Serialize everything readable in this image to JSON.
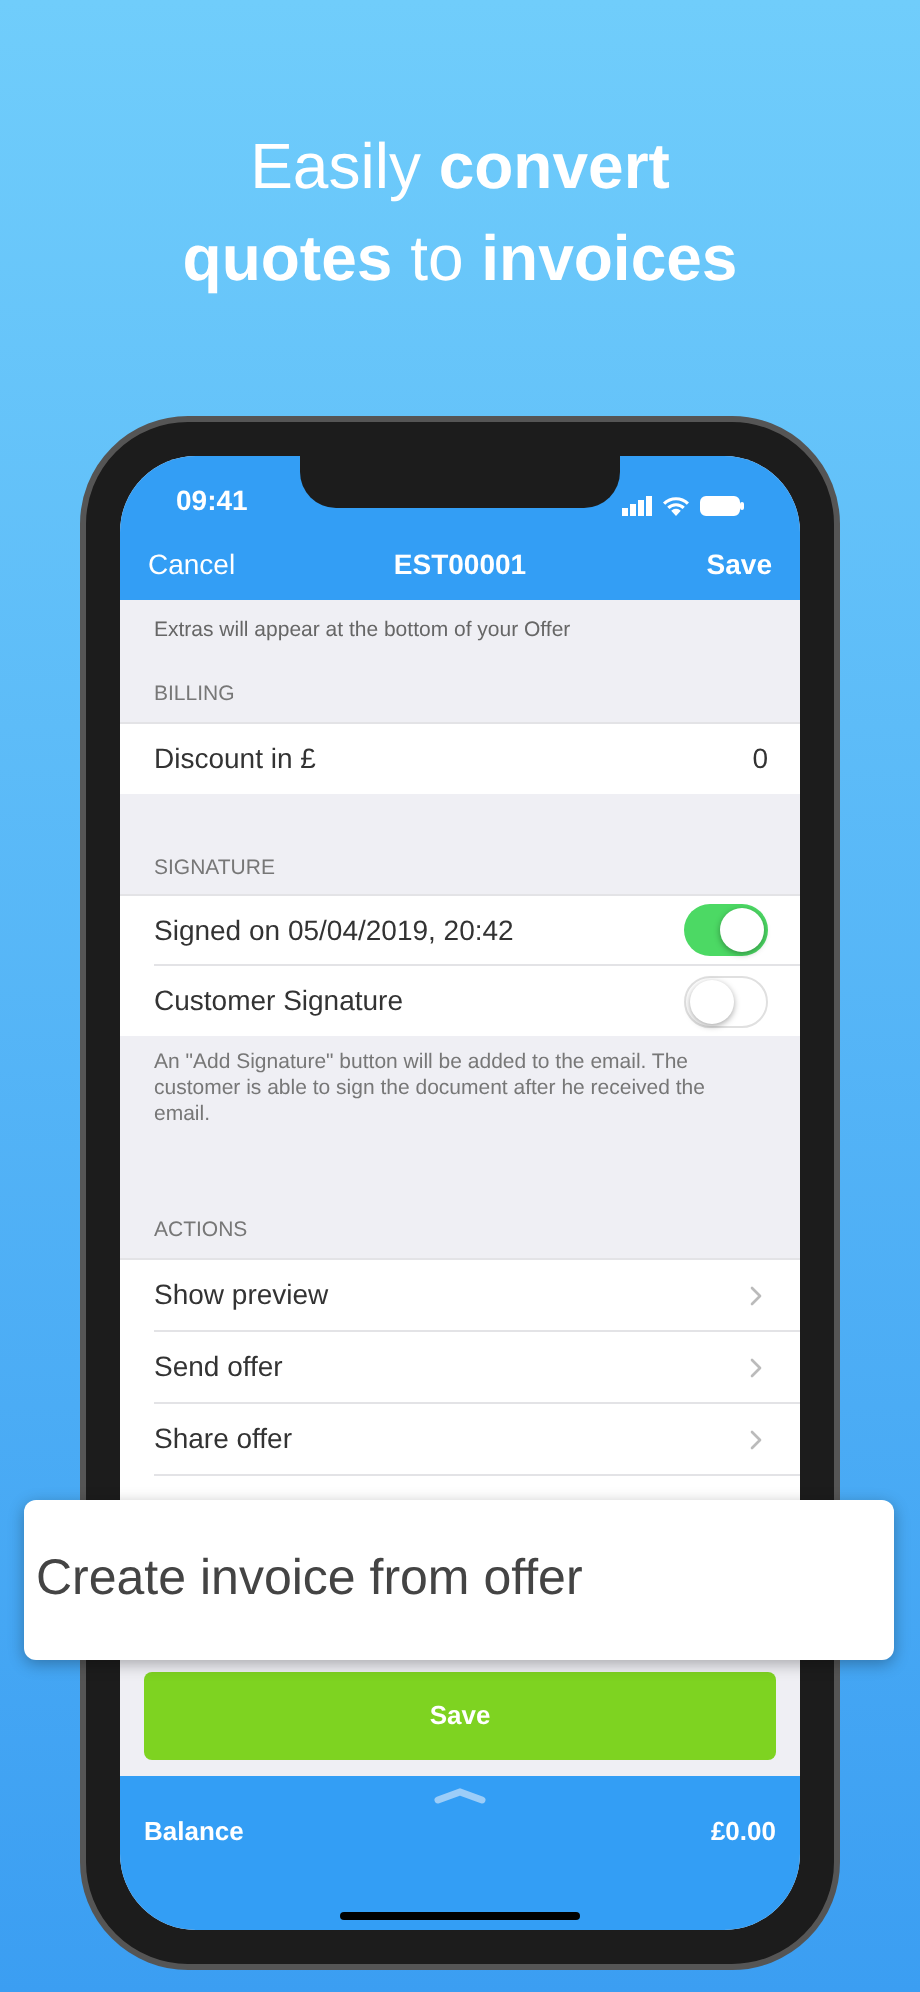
{
  "headline": [
    "Easily **convert**",
    "**quotes** to **invoices**"
  ],
  "status_bar": {
    "time": "09:41"
  },
  "nav": {
    "cancel": "Cancel",
    "title": "EST00001",
    "save": "Save"
  },
  "note": "Extras will appear at the bottom of your Offer",
  "sections": [
    {
      "header": "BILLING",
      "rows": [
        {
          "kind": "value",
          "label": "Discount in £",
          "value": "0"
        }
      ]
    },
    {
      "header": "SIGNATURE",
      "rows": [
        {
          "kind": "toggle",
          "label": "Signed on 05/04/2019, 20:42",
          "on": true
        },
        {
          "kind": "toggle",
          "label": "Customer Signature",
          "on": false
        }
      ],
      "footer": "An \"Add Signature\" button will be added to the email. The customer is able to sign the document after he received the email."
    },
    {
      "header": "ACTIONS",
      "rows": [
        {
          "kind": "link",
          "label": "Show preview"
        },
        {
          "kind": "link",
          "label": "Send offer"
        },
        {
          "kind": "link",
          "label": "Share offer"
        },
        {
          "kind": "hidden"
        }
      ]
    }
  ],
  "callout": "Create invoice from offer",
  "save_button": "Save",
  "balance": {
    "label": "Balance",
    "amount": "£0.00"
  }
}
